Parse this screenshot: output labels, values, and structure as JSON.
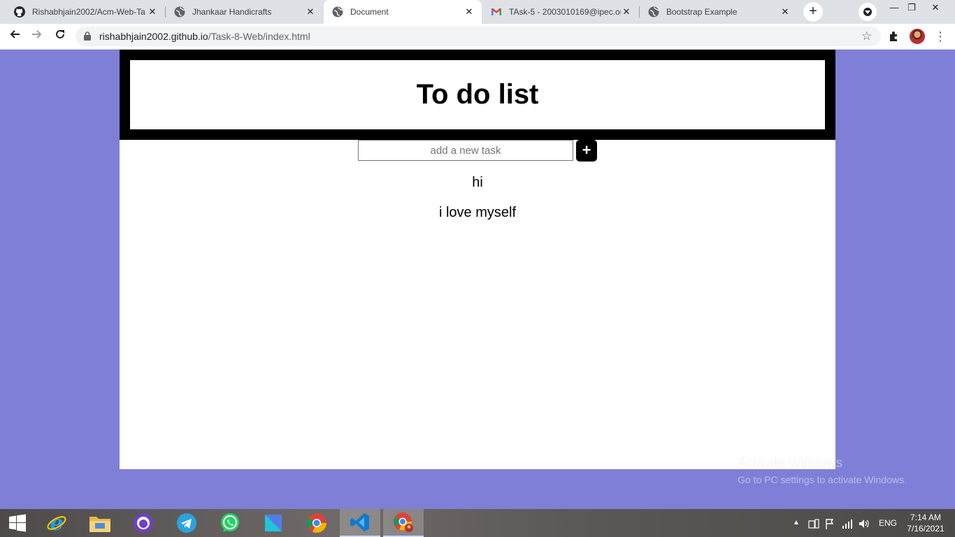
{
  "browser": {
    "tabs": [
      {
        "title": "Rishabhjain2002/Acm-Web-Ta",
        "icon": "github-icon",
        "active": false
      },
      {
        "title": "Jhankaar Handicrafts",
        "icon": "globe-icon",
        "active": false
      },
      {
        "title": "Document",
        "icon": "globe-icon",
        "active": true
      },
      {
        "title": "TAsk-5 - 2003010169@ipec.or",
        "icon": "gmail-icon",
        "active": false
      },
      {
        "title": "Bootstrap Example",
        "icon": "globe-icon",
        "active": false
      }
    ],
    "close_glyph": "✕",
    "new_tab_glyph": "+",
    "window_controls": {
      "minimize": "—",
      "restore": "❐",
      "close": "✕"
    },
    "url_host": "rishabhjain2002.github.io",
    "url_path": "/Task-8-Web/index.html"
  },
  "page": {
    "title": "To do list",
    "input": {
      "placeholder": "add a new task",
      "value": ""
    },
    "add_button_label": "+",
    "tasks": [
      "hi",
      "i love myself"
    ],
    "colors": {
      "background": "#7f7fd8",
      "header_border": "#000000",
      "card": "#ffffff"
    }
  },
  "os": {
    "watermark_title": "Activate Windows",
    "watermark_text": "Go to PC settings to activate Windows.",
    "taskbar_apps": [
      "windows-start-icon",
      "internet-explorer-icon",
      "file-explorer-icon",
      "github-desktop-icon",
      "telegram-icon",
      "whatsapp-icon",
      "app-icon",
      "chrome-icon",
      "vscode-icon",
      "chrome-profile-icon"
    ],
    "language": "ENG",
    "time": "7:14 AM",
    "date": "7/16/2021"
  }
}
